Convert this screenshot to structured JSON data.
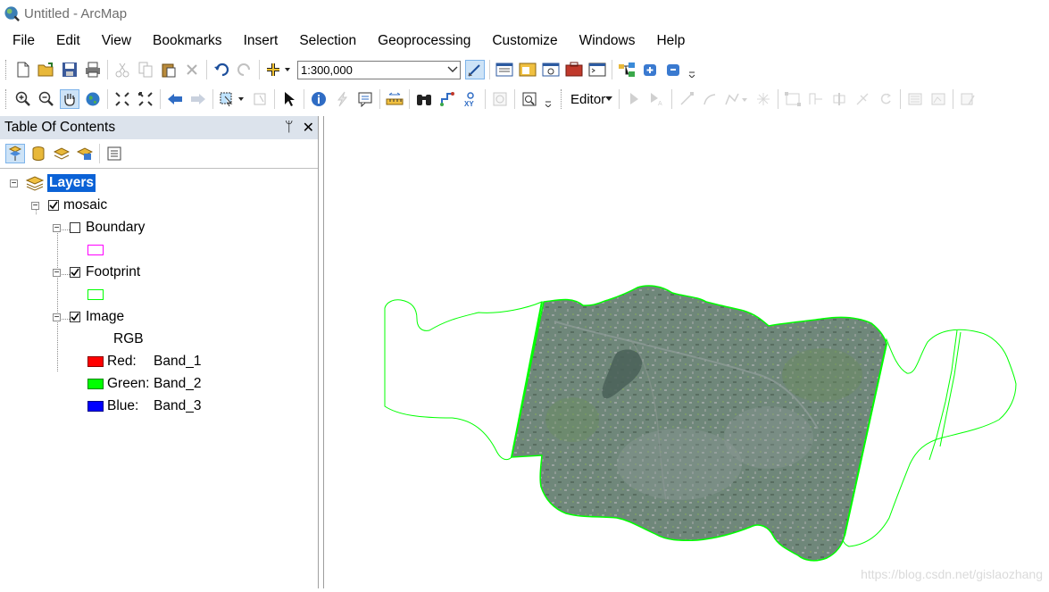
{
  "window": {
    "title": "Untitled - ArcMap",
    "app_icon": "arcmap-globe-icon"
  },
  "menu": [
    "File",
    "Edit",
    "View",
    "Bookmarks",
    "Insert",
    "Selection",
    "Geoprocessing",
    "Customize",
    "Windows",
    "Help"
  ],
  "toolbar": {
    "scale_value": "1:300,000",
    "editor_label": "Editor"
  },
  "toc": {
    "title": "Table Of Contents",
    "pin_glyph": "ᛘ",
    "close_glyph": "✕",
    "root_label": "Layers",
    "group_label": "mosaic",
    "layers": [
      {
        "label": "Boundary",
        "checked": false,
        "swatch_color": "#ff00ff"
      },
      {
        "label": "Footprint",
        "checked": true,
        "swatch_color": "#00ff00"
      },
      {
        "label": "Image",
        "checked": true
      }
    ],
    "rgb_heading": "RGB",
    "bands": [
      {
        "channel": "Red:",
        "band": "Band_1",
        "color": "#ff0000"
      },
      {
        "channel": "Green:",
        "band": "Band_2",
        "color": "#00ff00"
      },
      {
        "channel": "Blue:",
        "band": "Band_3",
        "color": "#0000ff"
      }
    ]
  },
  "map": {
    "footprint_color": "#00ff00",
    "imagery_tint": "#6f8a7a"
  },
  "watermark": "https://blog.csdn.net/gislaozhang"
}
